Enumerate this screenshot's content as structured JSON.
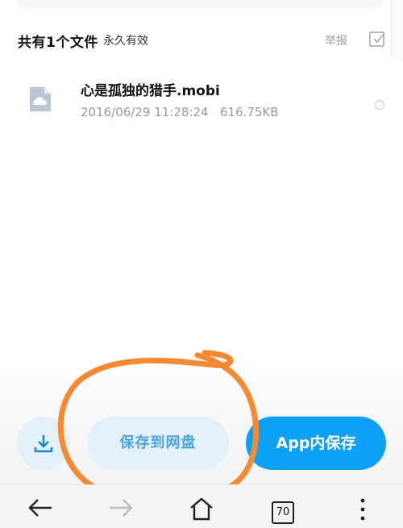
{
  "header": {
    "title": "共有1个文件",
    "subtitle": "永久有效",
    "report_label": "举报",
    "select_all_icon": "checkbox-icon"
  },
  "file": {
    "name": "心是孤独的猎手.mobi",
    "date": "2016/06/29 11:28:24",
    "size": "616.75KB",
    "icon": "cloud-file-icon"
  },
  "actions": {
    "download_icon": "download-icon",
    "save_to_disk_label": "保存到网盘",
    "app_save_label": "App内保存"
  },
  "navbar": {
    "back_icon": "arrow-left-icon",
    "forward_icon": "arrow-right-icon",
    "home_icon": "home-icon",
    "tab_count": "70",
    "menu_icon": "more-vertical-icon"
  },
  "colors": {
    "accent": "#0ea0f5",
    "accent_light": "#e4f1fb",
    "annotation": "#f58a33"
  }
}
